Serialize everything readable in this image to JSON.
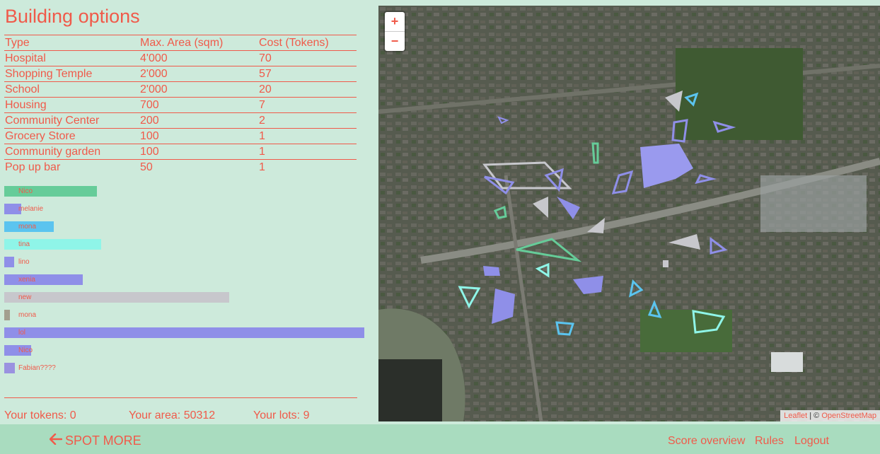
{
  "title": "Building options",
  "table": {
    "headers": [
      "Type",
      "Max. Area (sqm)",
      "Cost (Tokens)"
    ],
    "rows": [
      [
        "Hospital",
        "4'000",
        "70"
      ],
      [
        "Shopping Temple",
        "2'000",
        "57"
      ],
      [
        "School",
        "2'000",
        "20"
      ],
      [
        "Housing",
        "700",
        "7"
      ],
      [
        "Community Center",
        "200",
        "2"
      ],
      [
        "Grocery Store",
        "100",
        "1"
      ],
      [
        "Community garden",
        "100",
        "1"
      ],
      [
        "Pop up bar",
        "50",
        "1"
      ]
    ]
  },
  "players": [
    {
      "name": "Nico",
      "value": 0.257,
      "color": "#66cc99"
    },
    {
      "name": "melanie",
      "value": 0.047,
      "color": "#8f8fe8"
    },
    {
      "name": "mona",
      "value": 0.137,
      "color": "#5bc4ef"
    },
    {
      "name": "tina",
      "value": 0.27,
      "color": "#8ff5e8"
    },
    {
      "name": "lino",
      "value": 0.027,
      "color": "#8f8fe8"
    },
    {
      "name": "xenia",
      "value": 0.219,
      "color": "#8f8fe8"
    },
    {
      "name": "new",
      "value": 0.625,
      "color": "#c7c7cc"
    },
    {
      "name": "mona",
      "value": 0.016,
      "color": "#a39f8f"
    },
    {
      "name": "lol",
      "value": 1.0,
      "color": "#8f8fe8"
    },
    {
      "name": "Nico",
      "value": 0.074,
      "color": "#8f8fe8"
    },
    {
      "name": "Fabian????",
      "value": 0.029,
      "color": "#9a92e0"
    }
  ],
  "stats": {
    "tokens": "Your tokens: 0",
    "area": "Your area: 50312",
    "lots": "Your lots: 9"
  },
  "map": {
    "zoom_in": "+",
    "zoom_out": "−",
    "attribution_leaflet": "Leaflet",
    "attribution_sep": " | © ",
    "attribution_osm": "OpenStreetMap"
  },
  "footer": {
    "back_icon": "arrow-left-icon",
    "back_label": "SPOT MORE",
    "links": [
      "Score overview",
      "Rules",
      "Logout"
    ]
  }
}
